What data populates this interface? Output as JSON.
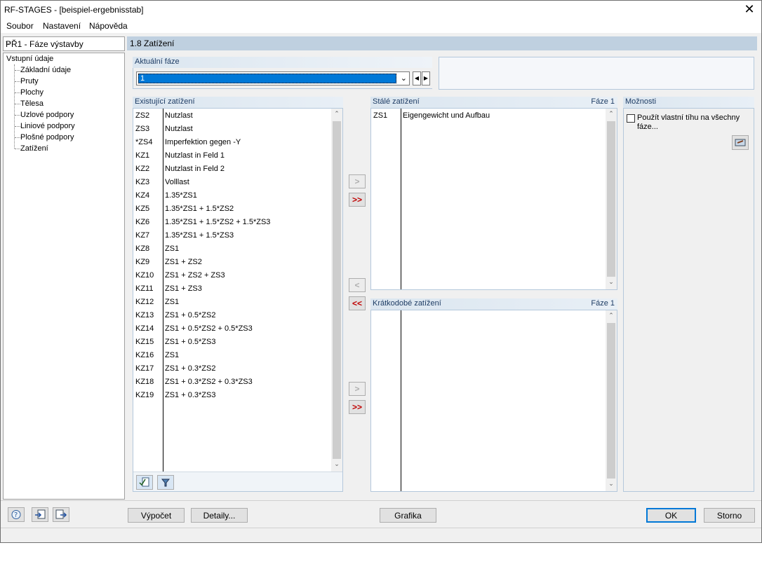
{
  "window": {
    "title": "RF-STAGES - [beispiel-ergebnisstab]",
    "close": "✕"
  },
  "menu": [
    "Soubor",
    "Nastavení",
    "Nápověda"
  ],
  "nav": {
    "selector": "PŘ1 - Fáze výstavby",
    "root": "Vstupní údaje",
    "items": [
      "Základní údaje",
      "Pruty",
      "Plochy",
      "Tělesa",
      "Uzlové podpory",
      "Liniové podpory",
      "Plošné podpory",
      "Zatížení"
    ]
  },
  "section": {
    "title": "1.8 Zatížení"
  },
  "current_phase": {
    "label": "Aktuální fáze",
    "value": "1"
  },
  "existing": {
    "label": "Existující zatížení",
    "rows": [
      {
        "id": "ZS2",
        "desc": "Nutzlast"
      },
      {
        "id": "ZS3",
        "desc": "Nutzlast"
      },
      {
        "id": "*ZS4",
        "desc": "Imperfektion gegen -Y"
      },
      {
        "id": "KZ1",
        "desc": "Nutzlast in Feld 1"
      },
      {
        "id": "KZ2",
        "desc": "Nutzlast in Feld 2"
      },
      {
        "id": "KZ3",
        "desc": "Volllast"
      },
      {
        "id": "KZ4",
        "desc": "1.35*ZS1"
      },
      {
        "id": "KZ5",
        "desc": "1.35*ZS1 + 1.5*ZS2"
      },
      {
        "id": "KZ6",
        "desc": "1.35*ZS1 + 1.5*ZS2 + 1.5*ZS3"
      },
      {
        "id": "KZ7",
        "desc": "1.35*ZS1 + 1.5*ZS3"
      },
      {
        "id": "KZ8",
        "desc": "ZS1"
      },
      {
        "id": "KZ9",
        "desc": "ZS1 + ZS2"
      },
      {
        "id": "KZ10",
        "desc": "ZS1 + ZS2 + ZS3"
      },
      {
        "id": "KZ11",
        "desc": "ZS1 + ZS3"
      },
      {
        "id": "KZ12",
        "desc": "ZS1"
      },
      {
        "id": "KZ13",
        "desc": "ZS1 + 0.5*ZS2"
      },
      {
        "id": "KZ14",
        "desc": "ZS1 + 0.5*ZS2 + 0.5*ZS3"
      },
      {
        "id": "KZ15",
        "desc": "ZS1 + 0.5*ZS3"
      },
      {
        "id": "KZ16",
        "desc": "ZS1"
      },
      {
        "id": "KZ17",
        "desc": "ZS1 + 0.3*ZS2"
      },
      {
        "id": "KZ18",
        "desc": "ZS1 + 0.3*ZS2 + 0.3*ZS3"
      },
      {
        "id": "KZ19",
        "desc": "ZS1 + 0.3*ZS3"
      }
    ]
  },
  "permanent": {
    "label": "Stálé zatížení",
    "phase": "Fáze 1",
    "rows": [
      {
        "id": "ZS1",
        "desc": "Eigengewicht und Aufbau"
      }
    ]
  },
  "short_term": {
    "label": "Krátkodobé zatížení",
    "phase": "Fáze 1",
    "rows": []
  },
  "options": {
    "label": "Možnosti",
    "checkbox_line1": "Použít vlastní tíhu na všechny",
    "checkbox_line2": "fáze..."
  },
  "move_buttons": {
    "single_right": ">",
    "all_right": ">>",
    "single_left": "<",
    "all_left": "<<"
  },
  "footer": {
    "calc": "Výpočet",
    "details": "Detaily...",
    "graphics": "Grafika",
    "ok": "OK",
    "cancel": "Storno"
  },
  "colors": {
    "accent": "#0078d7",
    "section_header": "#bfd0e0",
    "panel_border": "#b4c8dc",
    "arrow_red": "#c00000"
  }
}
